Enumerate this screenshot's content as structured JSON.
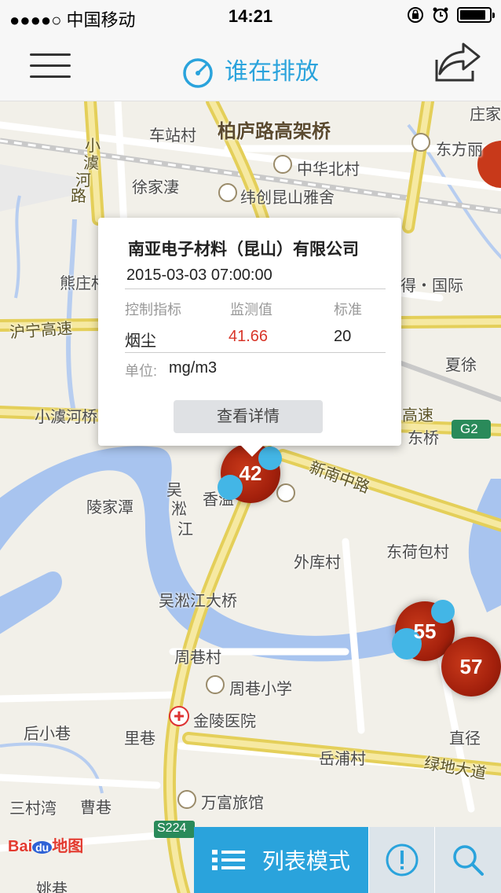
{
  "status": {
    "carrier": "●●●●○ 中国移动",
    "time": "14:21"
  },
  "navbar": {
    "title": "谁在排放"
  },
  "map_labels": [
    {
      "text": "柏庐路高架桥",
      "cls": "big"
    },
    {
      "text": "车站村",
      "cls": ""
    },
    {
      "text": "中华北村",
      "cls": ""
    },
    {
      "text": "东方丽",
      "cls": ""
    },
    {
      "text": "庄家",
      "cls": ""
    },
    {
      "text": "徐家淒",
      "cls": ""
    },
    {
      "text": "纬创昆山雅舍",
      "cls": ""
    },
    {
      "text": "小",
      "cls": "road"
    },
    {
      "text": "澞",
      "cls": "road"
    },
    {
      "text": "河",
      "cls": "road"
    },
    {
      "text": "路",
      "cls": "road"
    },
    {
      "text": "熊庄村",
      "cls": ""
    },
    {
      "text": "得・国际",
      "cls": ""
    },
    {
      "text": "沪宁高速",
      "cls": "road"
    },
    {
      "text": "夏徐",
      "cls": ""
    },
    {
      "text": "小澞河桥",
      "cls": ""
    },
    {
      "text": "高速",
      "cls": "road"
    },
    {
      "text": "东桥",
      "cls": ""
    },
    {
      "text": "G2",
      "cls": "white"
    },
    {
      "text": "新南中路",
      "cls": "road"
    },
    {
      "text": "陵家潭",
      "cls": ""
    },
    {
      "text": "吴",
      "cls": ""
    },
    {
      "text": "淞",
      "cls": ""
    },
    {
      "text": "江",
      "cls": ""
    },
    {
      "text": "香溢",
      "cls": ""
    },
    {
      "text": "外库村",
      "cls": ""
    },
    {
      "text": "东荷包村",
      "cls": ""
    },
    {
      "text": "吴淞江大桥",
      "cls": ""
    },
    {
      "text": "周巷村",
      "cls": ""
    },
    {
      "text": "周巷小学",
      "cls": ""
    },
    {
      "text": "后小巷",
      "cls": ""
    },
    {
      "text": "里巷",
      "cls": ""
    },
    {
      "text": "金陵医院",
      "cls": ""
    },
    {
      "text": "直径",
      "cls": ""
    },
    {
      "text": "岳浦村",
      "cls": ""
    },
    {
      "text": "绿地大道",
      "cls": "road"
    },
    {
      "text": "三村湾",
      "cls": ""
    },
    {
      "text": "曹巷",
      "cls": ""
    },
    {
      "text": "万富旅馆",
      "cls": ""
    },
    {
      "text": "S224",
      "cls": "white"
    },
    {
      "text": "姚巷",
      "cls": ""
    }
  ],
  "markers": [
    {
      "value": "42"
    },
    {
      "value": "55"
    },
    {
      "value": "57"
    }
  ],
  "popup": {
    "company": "南亚电子材料（昆山）有限公司",
    "datetime": "2015-03-03 07:00:00",
    "headers": [
      "控制指标",
      "监测值",
      "标准"
    ],
    "row": {
      "indicator": "烟尘",
      "value": "41.66",
      "standard": "20"
    },
    "unit_label": "单位:",
    "unit_value": "mg/m3",
    "detail_button": "查看详情"
  },
  "baidu": {
    "brand": "Bai",
    "du": "du",
    "map": "地图"
  },
  "bottom": {
    "list_mode": "列表模式"
  },
  "colors": {
    "accent": "#2aa3dc",
    "marker_red": "#b3240e",
    "marker_aqua": "#43b6e6",
    "value_red": "#d8362a"
  }
}
